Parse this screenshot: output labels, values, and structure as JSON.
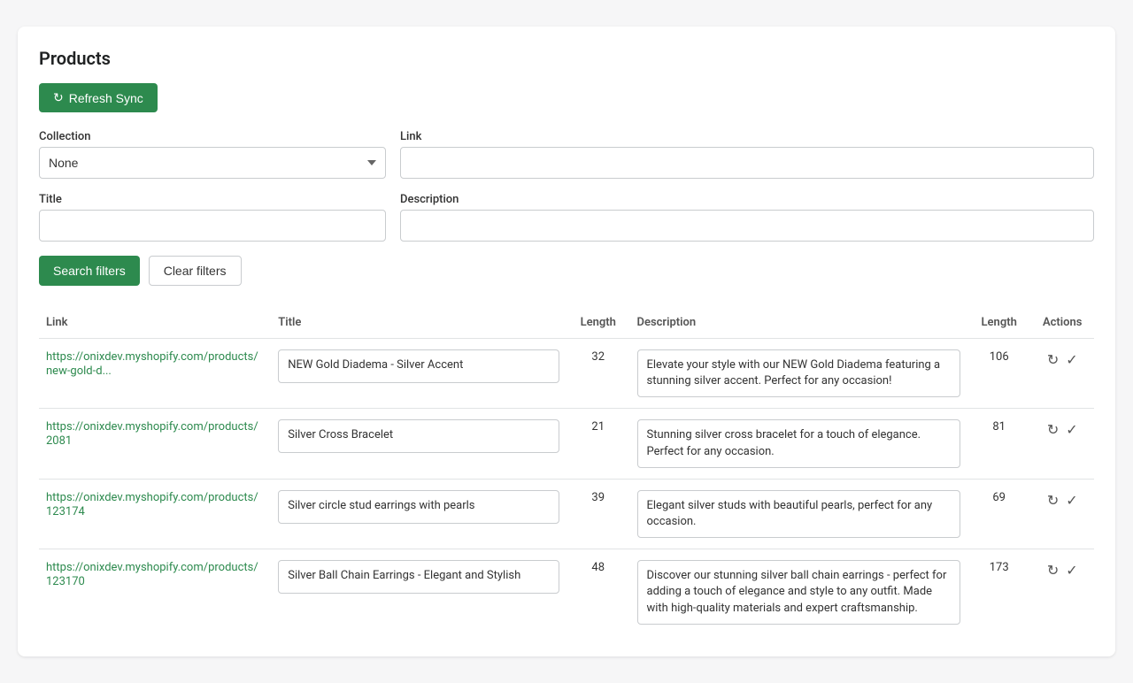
{
  "page": {
    "title": "Products"
  },
  "buttons": {
    "refresh_sync": "Refresh Sync",
    "search_filters": "Search filters",
    "clear_filters": "Clear filters"
  },
  "filters": {
    "collection_label": "Collection",
    "collection_value": "None",
    "collection_options": [
      "None"
    ],
    "link_label": "Link",
    "link_value": "",
    "link_placeholder": "",
    "title_label": "Title",
    "title_value": "",
    "title_placeholder": "",
    "description_label": "Description",
    "description_value": "",
    "description_placeholder": ""
  },
  "table": {
    "columns": {
      "link": "Link",
      "title": "Title",
      "length_title": "Length",
      "description": "Description",
      "length_desc": "Length",
      "actions": "Actions"
    },
    "rows": [
      {
        "link_url": "https://onixdev.myshopify.com/products/new-gold-d...",
        "link_href": "https://onixdev.myshopify.com/products/new-gold-d",
        "title": "NEW Gold Diadema - Silver Accent",
        "title_length": 32,
        "description": "Elevate your style with our NEW Gold Diadema featuring a stunning silver accent. Perfect for any occasion!",
        "desc_length": 106
      },
      {
        "link_url": "https://onixdev.myshopify.com/products/2081",
        "link_href": "https://onixdev.myshopify.com/products/2081",
        "title": "Silver Cross Bracelet",
        "title_length": 21,
        "description": "Stunning silver cross bracelet for a touch of elegance. Perfect for any occasion.",
        "desc_length": 81
      },
      {
        "link_url": "https://onixdev.myshopify.com/products/123174",
        "link_href": "https://onixdev.myshopify.com/products/123174",
        "title": "Silver circle stud earrings with pearls",
        "title_length": 39,
        "description": "Elegant silver studs with beautiful pearls, perfect for any occasion.",
        "desc_length": 69
      },
      {
        "link_url": "https://onixdev.myshopify.com/products/123170",
        "link_href": "https://onixdev.myshopify.com/products/123170",
        "title": "Silver Ball Chain Earrings - Elegant and Stylish",
        "title_length": 48,
        "description": "Discover our stunning silver ball chain earrings - perfect for adding a touch of elegance and style to any outfit. Made with high-quality materials and expert craftsmanship.",
        "desc_length": 173
      }
    ]
  }
}
